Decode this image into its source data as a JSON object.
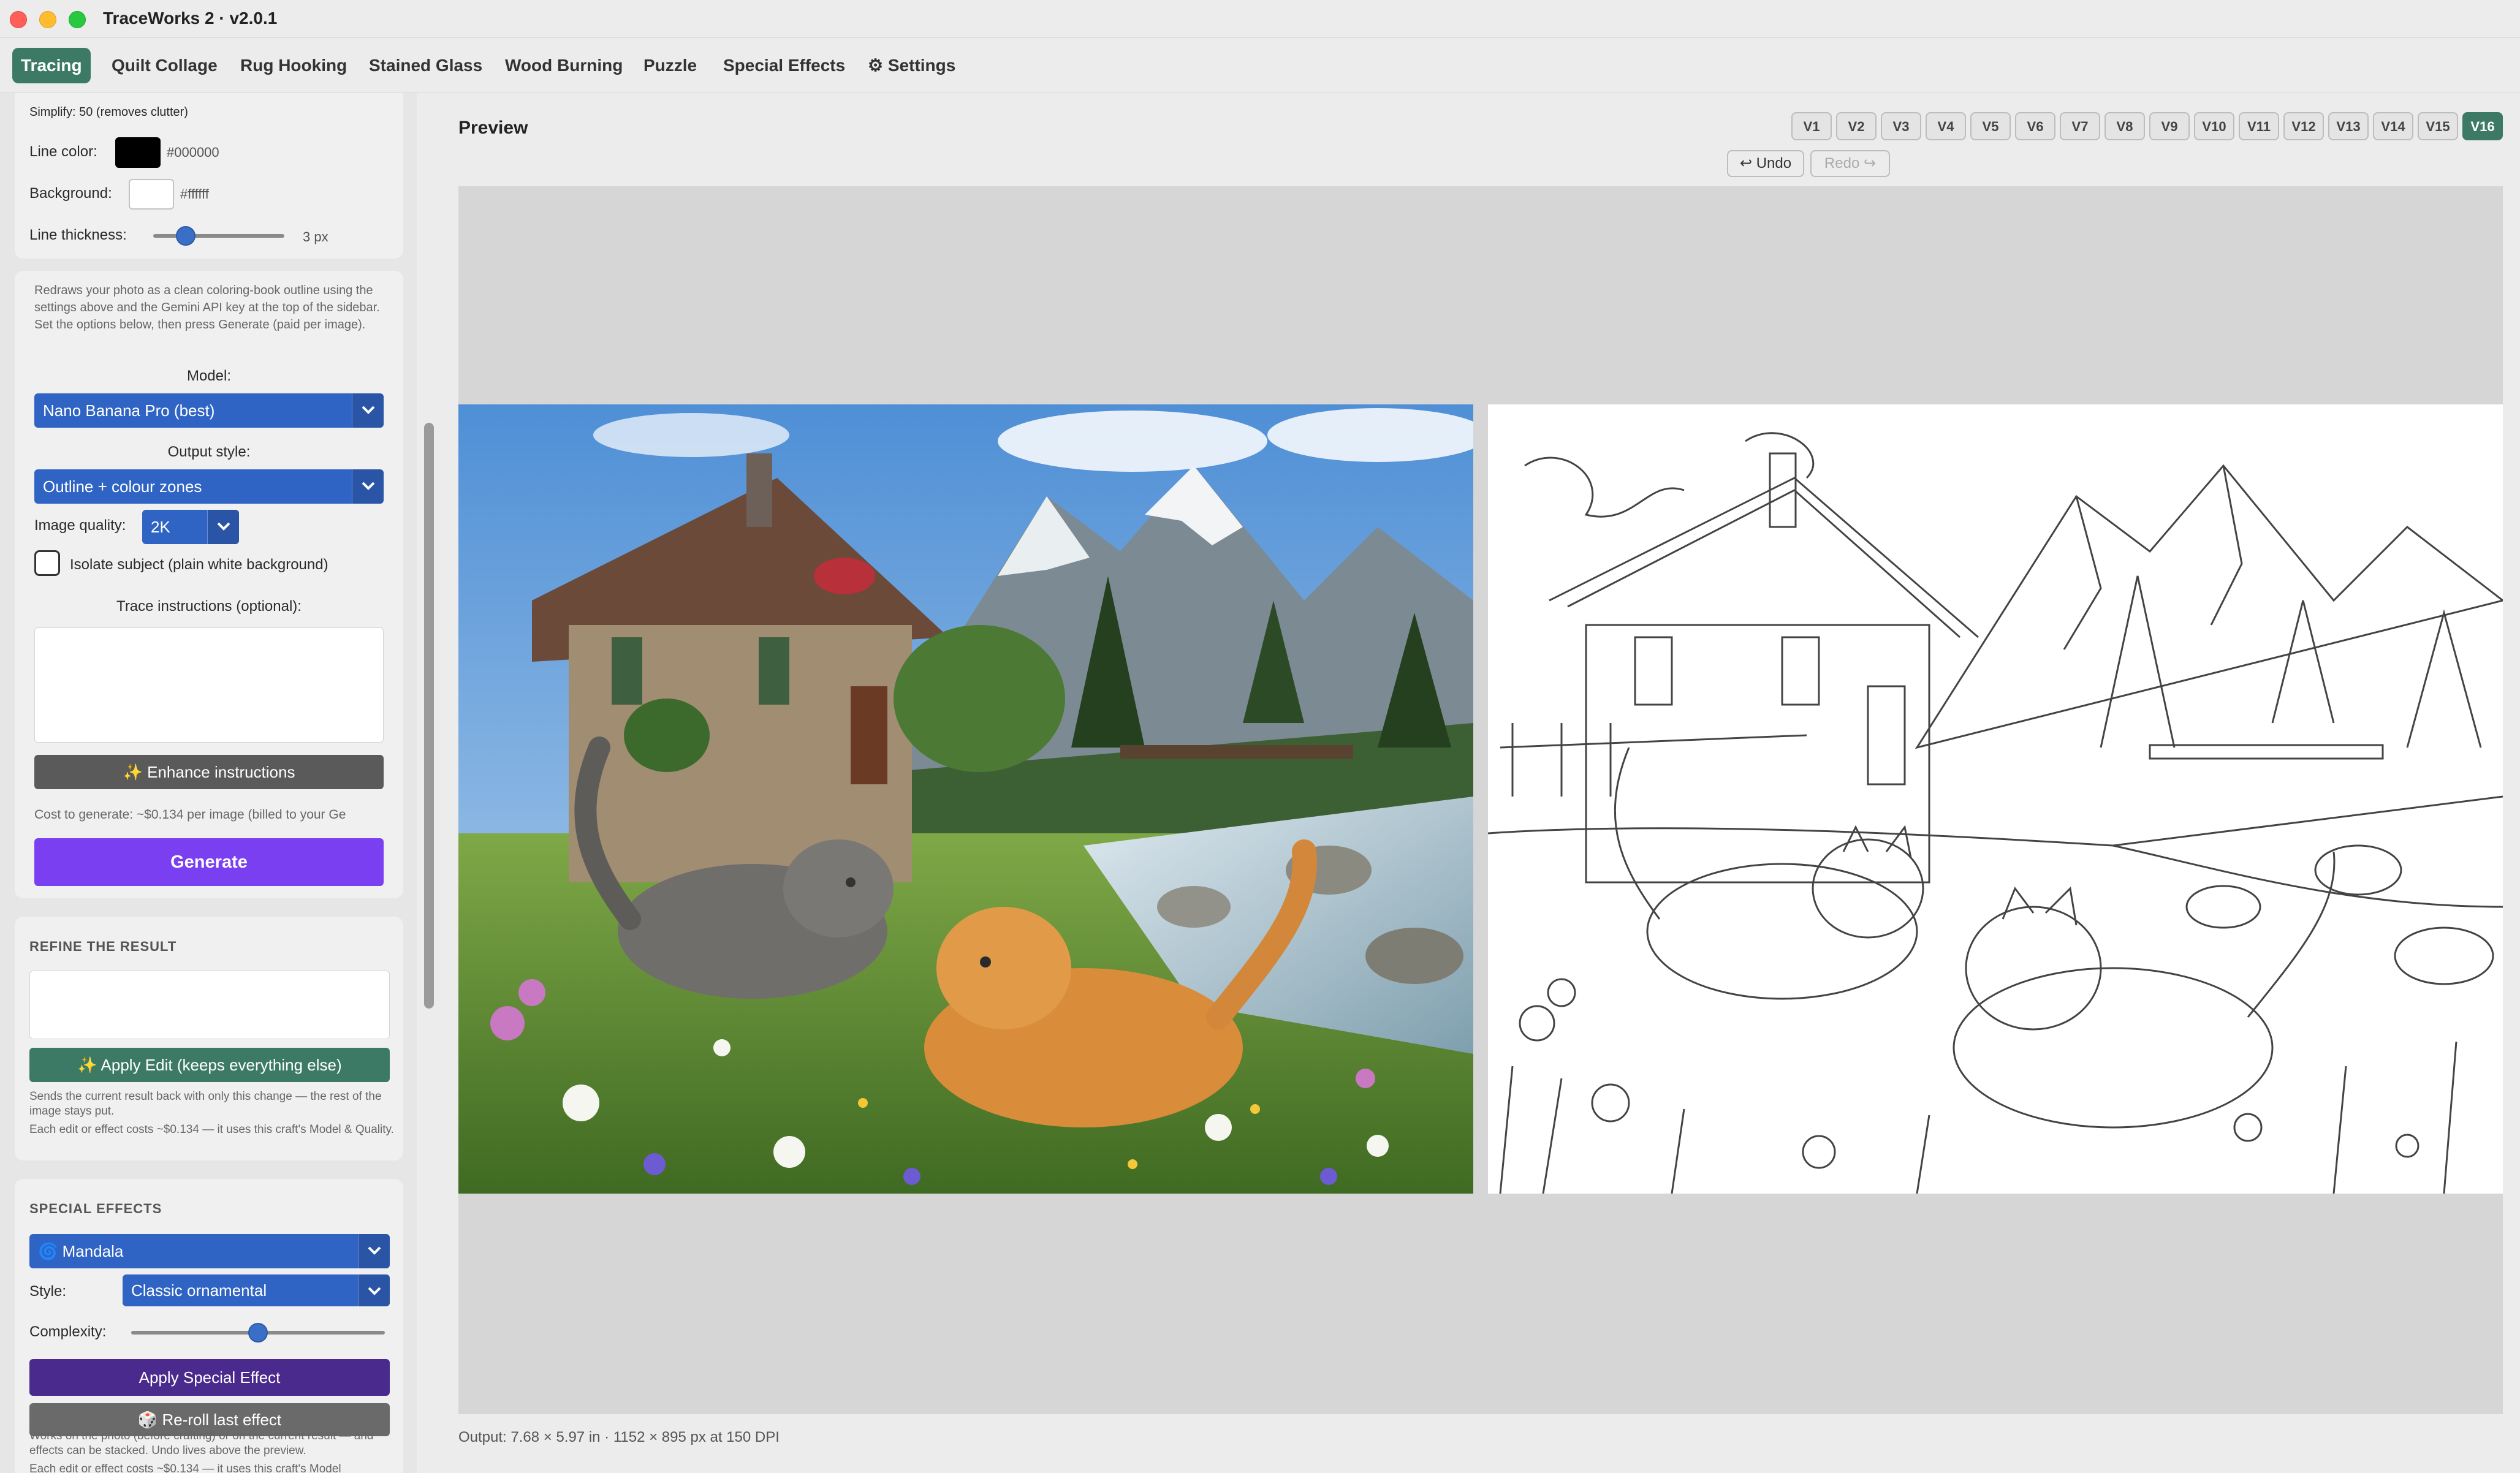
{
  "window": {
    "title": "TraceWorks 2  ·  v2.0.1"
  },
  "tabs": [
    {
      "label": "Tracing",
      "active": true
    },
    {
      "label": "Quilt Collage"
    },
    {
      "label": "Rug Hooking"
    },
    {
      "label": "Stained Glass"
    },
    {
      "label": "Wood Burning"
    },
    {
      "label": "Puzzle"
    },
    {
      "label": "Special Effects"
    },
    {
      "label": "⚙ Settings"
    }
  ],
  "tracing_settings": {
    "simplify": "Simplify: 50  (removes clutter)",
    "line_color_label": "Line color:",
    "line_color_hex": "#000000",
    "background_label": "Background:",
    "background_hex": "#ffffff",
    "line_thickness_label": "Line thickness:",
    "line_thickness_value": "3 px",
    "line_thickness_fraction": 0.2
  },
  "ai_trace": {
    "description": "Redraws your photo as a clean coloring-book outline using the settings above and the Gemini API key at the top of the sidebar. Set the options below, then press Generate (paid per image).",
    "model_label": "Model:",
    "model_value": "Nano Banana Pro (best)",
    "output_style_label": "Output style:",
    "output_style_value": "Outline + colour zones",
    "image_quality_label": "Image quality:",
    "image_quality_value": "2K",
    "isolate_label": "Isolate subject (plain white background)",
    "isolate_checked": false,
    "trace_instructions_label": "Trace instructions (optional):",
    "trace_instructions_value": "",
    "enhance_label": "✨ Enhance instructions",
    "cost_text": "Cost to generate: ~$0.134 per image (billed to your Ge",
    "generate_label": "Generate"
  },
  "refine": {
    "title": "REFINE THE RESULT",
    "input_value": "",
    "apply_label": "✨ Apply Edit  (keeps everything else)",
    "note1": "Sends the current result back with only this change — the rest of the image stays put.",
    "note2": "Each edit or effect costs ~$0.134 — it uses this craft's Model & Quality."
  },
  "special_effects": {
    "title": "SPECIAL EFFECTS",
    "effect_value": "🌀 Mandala",
    "style_label": "Style:",
    "style_value": "Classic ornamental",
    "complexity_label": "Complexity:",
    "complexity_fraction": 0.5,
    "apply_label": "Apply Special Effect",
    "reroll_label": "🎲 Re-roll last effect",
    "note": "Works on the photo (before crafting) or on the current result — and effects can be stacked. Undo lives above the preview.",
    "note_cut": "Each edit or effect costs ~$0.134 — it uses this craft's Model"
  },
  "preview": {
    "title": "Preview",
    "versions": [
      "V1",
      "V2",
      "V3",
      "V4",
      "V5",
      "V6",
      "V7",
      "V8",
      "V9",
      "V10",
      "V11",
      "V12",
      "V13",
      "V14",
      "V15",
      "V16"
    ],
    "active_version": "V16",
    "undo_label": "↩ Undo",
    "redo_label": "Redo ↪",
    "status": "Output: 7.68 × 5.97 in  ·  1152 × 895 px at 150 DPI"
  },
  "colors": {
    "accent_green": "#3d7a66",
    "select_blue": "#2f64c5",
    "generate_purple": "#7a3ff0",
    "effect_purple": "#4a2a8c"
  }
}
